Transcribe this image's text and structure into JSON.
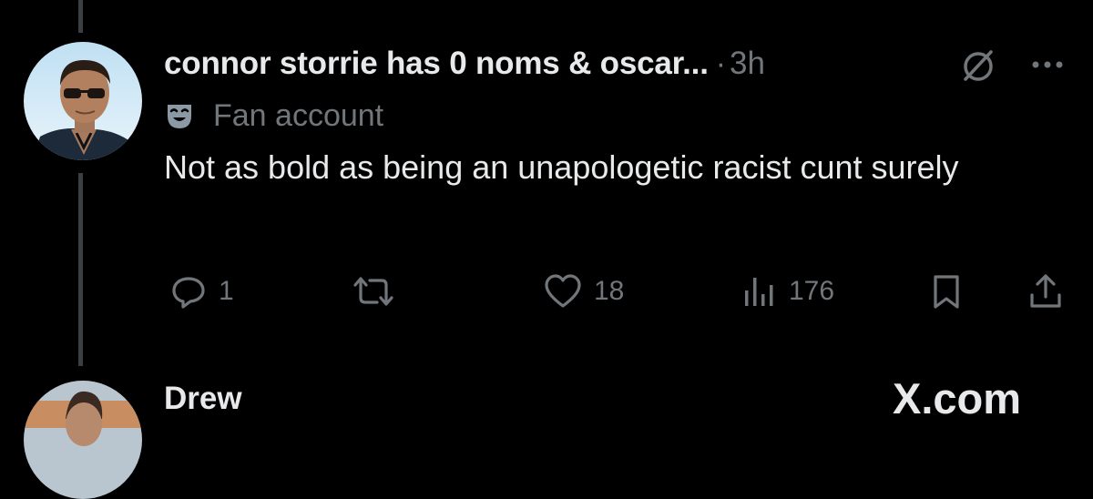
{
  "tweet": {
    "display_name": "connor storrie has 0 noms & oscar...",
    "separator": "·",
    "timestamp": "3h",
    "badge_label": "Fan account",
    "text": "Not as bold as being an unapologetic racist cunt surely",
    "metrics": {
      "replies": "1",
      "likes": "18",
      "views": "176"
    }
  },
  "next_tweet": {
    "display_name": "Drew"
  },
  "watermark": "X.com",
  "icons": {
    "grok": "grok-icon",
    "more": "more-icon",
    "badge": "theater-mask-icon",
    "reply": "reply-icon",
    "repost": "repost-icon",
    "like": "heart-icon",
    "views": "views-icon",
    "bookmark": "bookmark-icon",
    "share": "share-icon"
  },
  "colors": {
    "background": "#000000",
    "primary_text": "#e7e9ea",
    "secondary_text": "#71767b",
    "thread_line": "#3b3e42"
  }
}
